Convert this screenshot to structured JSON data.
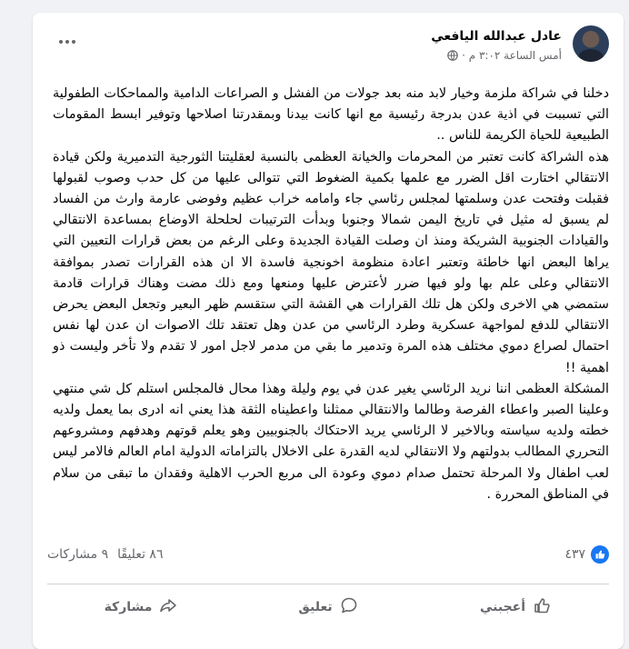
{
  "post": {
    "author": "عادل عبدالله اليافعي",
    "timestamp": "أمس الساعة ٣:٠٢ م ·",
    "body": [
      "دخلنا في شراكة ملزمة وخيار لابد منه بعد جولات من الفشل و الصراعات الدامية والمماحكات الطفولية التي تسببت في اذية عدن بدرجة رئيسية مع انها كانت بيدنا وبمقدرتنا اصلاحها وتوفير ابسط المقومات الطبيعية للحياة الكريمة للناس ..",
      "هذه الشراكة كانت تعتبر من المحرمات والخيانة العظمى بالنسبة لعقليتنا الثورجية التدميرية ولكن قيادة الانتقالي اختارت اقل الضرر مع علمها بكمية الضغوط التي تتوالى عليها من كل حدب وصوب لقبولها فقبلت وفتحت عدن وسلمتها لمجلس رئاسي جاء وامامه خراب عظيم وفوضى عارمة وارث من الفساد لم يسبق له مثيل في تاريخ اليمن شمالا وجنوبا وبدأت الترتيبات لحلحلة الاوضاع بمساعدة الانتقالي والقيادات الجنوبية الشريكة ومنذ ان وصلت القيادة الجديدة وعلى الرغم من بعض قرارات التعيين التي يراها البعض انها خاطئة وتعتبر اعادة منظومة اخونجية فاسدة الا ان هذه القرارات تصدر بموافقة الانتقالي وعلى علم بها ولو فيها ضرر لأعترض عليها ومنعها ومع ذلك مضت وهناك قرارات قادمة ستمضي هي الاخرى ولكن هل تلك القرارات هي القشة التي ستقسم ظهر البعير وتجعل البعض يحرض الانتقالي للدفع لمواجهة عسكرية وطرد الرئاسي من عدن وهل تعتقد تلك الاصوات ان عدن لها نفس احتمال لصراع دموي مختلف هذه المرة وتدمير ما بقي من مدمر لاجل امور لا تقدم ولا تأخر وليست ذو اهمية !!",
      "المشكلة العظمى اننا نريد الرئاسي يغير عدن في يوم وليلة وهذا محال فالمجلس استلم كل شي منتهي وعلينا الصبر واعطاء الفرصة وطالما والانتقالي ممثلنا واعطيناه الثقة هذا يعني انه ادرى بما يعمل ولديه خطته ولديه سياسته وبالاخير لا الرئاسي يريد الاحتكاك بالجنوبيين وهو يعلم قوتهم وهدفهم ومشروعهم التحرري المطالب بدولتهم ولا الانتقالي لديه القدرة على الاخلال بالتزاماته الدولية امام العالم فالامر ليس لعب اطفال ولا المرحلة تحتمل صدام دموي وعودة الى مربع الحرب الاهلية وفقدان ما تبقى من سلام في المناطق المحررة ."
    ]
  },
  "stats": {
    "reactions_count": "٤٣٧",
    "comments": "٨٦ تعليقًا",
    "shares": "٩ مشاركات"
  },
  "actions": {
    "like": "أعجبني",
    "comment": "تعليق",
    "share": "مشاركة"
  }
}
